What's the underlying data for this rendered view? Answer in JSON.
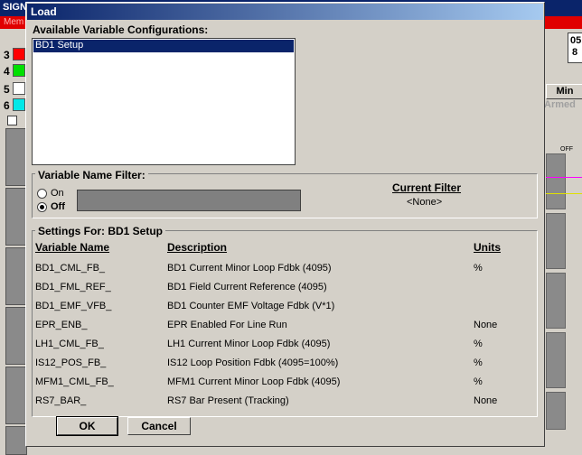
{
  "background": {
    "window_title": "SIGN",
    "menu_strip": "Mem",
    "channels": [
      {
        "num": "3",
        "color": "#ff0000"
      },
      {
        "num": "4",
        "color": "#00e000"
      },
      {
        "num": "5",
        "color": "#ffffff"
      },
      {
        "num": "6",
        "color": "#00e8e8"
      }
    ],
    "right_value_top": "05",
    "right_value_bottom": "8",
    "right_button": "Min",
    "right_status": "Armed",
    "right_off": "OFF"
  },
  "dialog": {
    "title": "Load",
    "configs_label": "Available  Variable Configurations:",
    "configs": [
      "BD1 Setup"
    ],
    "selected_config": "BD1 Setup",
    "filter_group_label": "Variable Name Filter:",
    "filter_on": "On",
    "filter_off": "Off",
    "filter_value": "",
    "current_filter_label": "Current Filter",
    "current_filter_value": "<None>",
    "settings_label": "Settings For:  BD1 Setup",
    "columns": {
      "name": "Variable Name",
      "description": "Description",
      "units": "Units"
    },
    "rows": [
      {
        "name": "BD1_CML_FB_",
        "description": "BD1 Current Minor Loop Fdbk (4095)",
        "units": "%"
      },
      {
        "name": "BD1_FML_REF_",
        "description": "BD1 Field Current Reference (4095)",
        "units": ""
      },
      {
        "name": "BD1_EMF_VFB_",
        "description": "BD1 Counter EMF Voltage Fdbk (V*1)",
        "units": ""
      },
      {
        "name": "EPR_ENB_",
        "description": "EPR Enabled For Line Run",
        "units": "None"
      },
      {
        "name": "LH1_CML_FB_",
        "description": "LH1 Current Minor Loop Fdbk (4095)",
        "units": "%"
      },
      {
        "name": "IS12_POS_FB_",
        "description": "IS12 Loop Position Fdbk (4095=100%)",
        "units": "%"
      },
      {
        "name": "MFM1_CML_FB_",
        "description": "MFM1 Current Minor Loop Fdbk (4095)",
        "units": "%"
      },
      {
        "name": "RS7_BAR_",
        "description": "RS7 Bar Present (Tracking)",
        "units": "None"
      }
    ],
    "ok_label": "OK",
    "cancel_label": "Cancel"
  }
}
